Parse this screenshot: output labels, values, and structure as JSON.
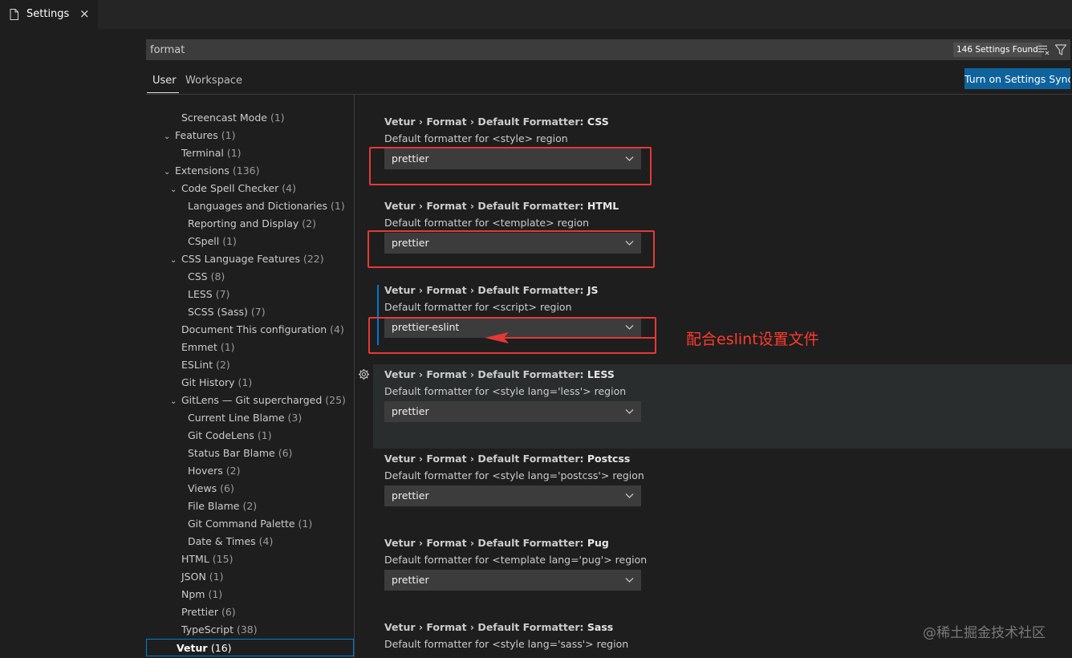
{
  "tab": {
    "label": "Settings",
    "close": "×"
  },
  "search": {
    "value": "format",
    "results_count": "146 Settings Found"
  },
  "scopes": {
    "user": "User",
    "workspace": "Workspace"
  },
  "sync_button": "Turn on Settings Sync",
  "toc": [
    {
      "label": "Screencast Mode",
      "count": "(1)",
      "level": 1,
      "chevron": ""
    },
    {
      "label": "Features",
      "count": "(1)",
      "level": 0,
      "chevron": "⌄"
    },
    {
      "label": "Terminal",
      "count": "(1)",
      "level": 1,
      "chevron": ""
    },
    {
      "label": "Extensions",
      "count": "(136)",
      "level": 0,
      "chevron": "⌄"
    },
    {
      "label": "Code Spell Checker",
      "count": "(4)",
      "level": 1,
      "chevron": "⌄"
    },
    {
      "label": "Languages and Dictionaries",
      "count": "(1)",
      "level": 2,
      "chevron": ""
    },
    {
      "label": "Reporting and Display",
      "count": "(2)",
      "level": 2,
      "chevron": ""
    },
    {
      "label": "CSpell",
      "count": "(1)",
      "level": 2,
      "chevron": ""
    },
    {
      "label": "CSS Language Features",
      "count": "(22)",
      "level": 1,
      "chevron": "⌄"
    },
    {
      "label": "CSS",
      "count": "(8)",
      "level": 2,
      "chevron": ""
    },
    {
      "label": "LESS",
      "count": "(7)",
      "level": 2,
      "chevron": ""
    },
    {
      "label": "SCSS (Sass)",
      "count": "(7)",
      "level": 2,
      "chevron": ""
    },
    {
      "label": "Document This configuration",
      "count": "(4)",
      "level": 1,
      "chevron": ""
    },
    {
      "label": "Emmet",
      "count": "(1)",
      "level": 1,
      "chevron": ""
    },
    {
      "label": "ESLint",
      "count": "(2)",
      "level": 1,
      "chevron": ""
    },
    {
      "label": "Git History",
      "count": "(1)",
      "level": 1,
      "chevron": ""
    },
    {
      "label": "GitLens — Git supercharged",
      "count": "(25)",
      "level": 1,
      "chevron": "⌄"
    },
    {
      "label": "Current Line Blame",
      "count": "(3)",
      "level": 2,
      "chevron": ""
    },
    {
      "label": "Git CodeLens",
      "count": "(1)",
      "level": 2,
      "chevron": ""
    },
    {
      "label": "Status Bar Blame",
      "count": "(6)",
      "level": 2,
      "chevron": ""
    },
    {
      "label": "Hovers",
      "count": "(2)",
      "level": 2,
      "chevron": ""
    },
    {
      "label": "Views",
      "count": "(6)",
      "level": 2,
      "chevron": ""
    },
    {
      "label": "File Blame",
      "count": "(2)",
      "level": 2,
      "chevron": ""
    },
    {
      "label": "Git Command Palette",
      "count": "(1)",
      "level": 2,
      "chevron": ""
    },
    {
      "label": "Date & Times",
      "count": "(4)",
      "level": 2,
      "chevron": ""
    },
    {
      "label": "HTML",
      "count": "(15)",
      "level": 1,
      "chevron": ""
    },
    {
      "label": "JSON",
      "count": "(1)",
      "level": 1,
      "chevron": ""
    },
    {
      "label": "Npm",
      "count": "(1)",
      "level": 1,
      "chevron": ""
    },
    {
      "label": "Prettier",
      "count": "(6)",
      "level": 1,
      "chevron": ""
    },
    {
      "label": "TypeScript",
      "count": "(38)",
      "level": 1,
      "chevron": ""
    },
    {
      "label": "Vetur",
      "count": "(16)",
      "level": 1,
      "chevron": "",
      "selected": true
    }
  ],
  "settings": [
    {
      "category": "Vetur › Format › Default Formatter: ",
      "key": "CSS",
      "description": "Default formatter for <style> region",
      "value": "prettier"
    },
    {
      "category": "Vetur › Format › Default Formatter: ",
      "key": "HTML",
      "description": "Default formatter for <template> region",
      "value": "prettier"
    },
    {
      "category": "Vetur › Format › Default Formatter: ",
      "key": "JS",
      "description": "Default formatter for <script> region",
      "value": "prettier-eslint"
    },
    {
      "category": "Vetur › Format › Default Formatter: ",
      "key": "LESS",
      "description": "Default formatter for <style lang='less'> region",
      "value": "prettier"
    },
    {
      "category": "Vetur › Format › Default Formatter: ",
      "key": "Postcss",
      "description": "Default formatter for <style lang='postcss'> region",
      "value": "prettier"
    },
    {
      "category": "Vetur › Format › Default Formatter: ",
      "key": "Pug",
      "description": "Default formatter for <template lang='pug'> region",
      "value": "prettier"
    },
    {
      "category": "Vetur › Format › Default Formatter: ",
      "key": "Sass",
      "description": "Default formatter for <style lang='sass'> region",
      "value": ""
    }
  ],
  "annotation": {
    "text": "配合eslint设置文件",
    "color": "#ff3b2f"
  },
  "watermark": "@稀土掘金技术社区",
  "colors": {
    "accent": "#0e639c",
    "focus": "#007fd4",
    "annotation_red": "#e53935"
  },
  "icons": {
    "tab": "file-icon",
    "clear": "clear-filter-icon",
    "filter": "filter-icon",
    "gear": "gear-icon",
    "dropdown": "chevron-down-icon"
  }
}
